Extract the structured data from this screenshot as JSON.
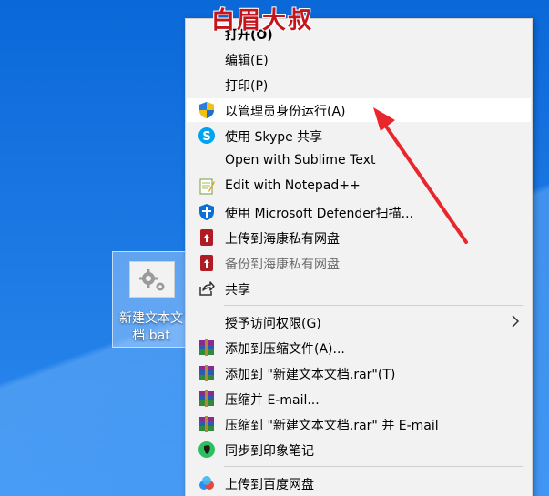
{
  "watermark": "白眉大叔",
  "desktop": {
    "file_name": "新建文本文档.bat"
  },
  "menu": {
    "items": [
      {
        "label": "打开(O)",
        "icon": "none",
        "bold": true
      },
      {
        "label": "编辑(E)",
        "icon": "none"
      },
      {
        "label": "打印(P)",
        "icon": "none"
      },
      {
        "label": "以管理员身份运行(A)",
        "icon": "uac-shield-icon",
        "highlighted": true
      },
      {
        "label": "使用 Skype 共享",
        "icon": "skype-icon"
      },
      {
        "label": "Open with Sublime Text",
        "icon": "none"
      },
      {
        "label": "Edit with Notepad++",
        "icon": "notepad-plus-plus-icon"
      },
      {
        "label": "使用 Microsoft Defender扫描...",
        "icon": "defender-shield-icon"
      },
      {
        "label": "上传到海康私有网盘",
        "icon": "hikvision-cloud-icon"
      },
      {
        "label": "备份到海康私有网盘",
        "icon": "hikvision-cloud-icon",
        "disabled": true
      },
      {
        "label": "共享",
        "icon": "share-icon"
      },
      {
        "label": "授予访问权限(G)",
        "icon": "none",
        "submenu": true
      },
      {
        "label": "添加到压缩文件(A)...",
        "icon": "winrar-icon"
      },
      {
        "label": "添加到 \"新建文本文档.rar\"(T)",
        "icon": "winrar-icon"
      },
      {
        "label": "压缩并 E-mail...",
        "icon": "winrar-icon"
      },
      {
        "label": "压缩到 \"新建文本文档.rar\" 并 E-mail",
        "icon": "winrar-icon"
      },
      {
        "label": "同步到印象笔记",
        "icon": "evernote-icon"
      },
      {
        "label": "上传到百度网盘",
        "icon": "baidu-netdisk-icon"
      }
    ]
  },
  "colors": {
    "menu_bg": "#f2f2f2",
    "highlight_bg": "#ffffff",
    "arrow": "#e8262b",
    "watermark": "#c4141c"
  }
}
